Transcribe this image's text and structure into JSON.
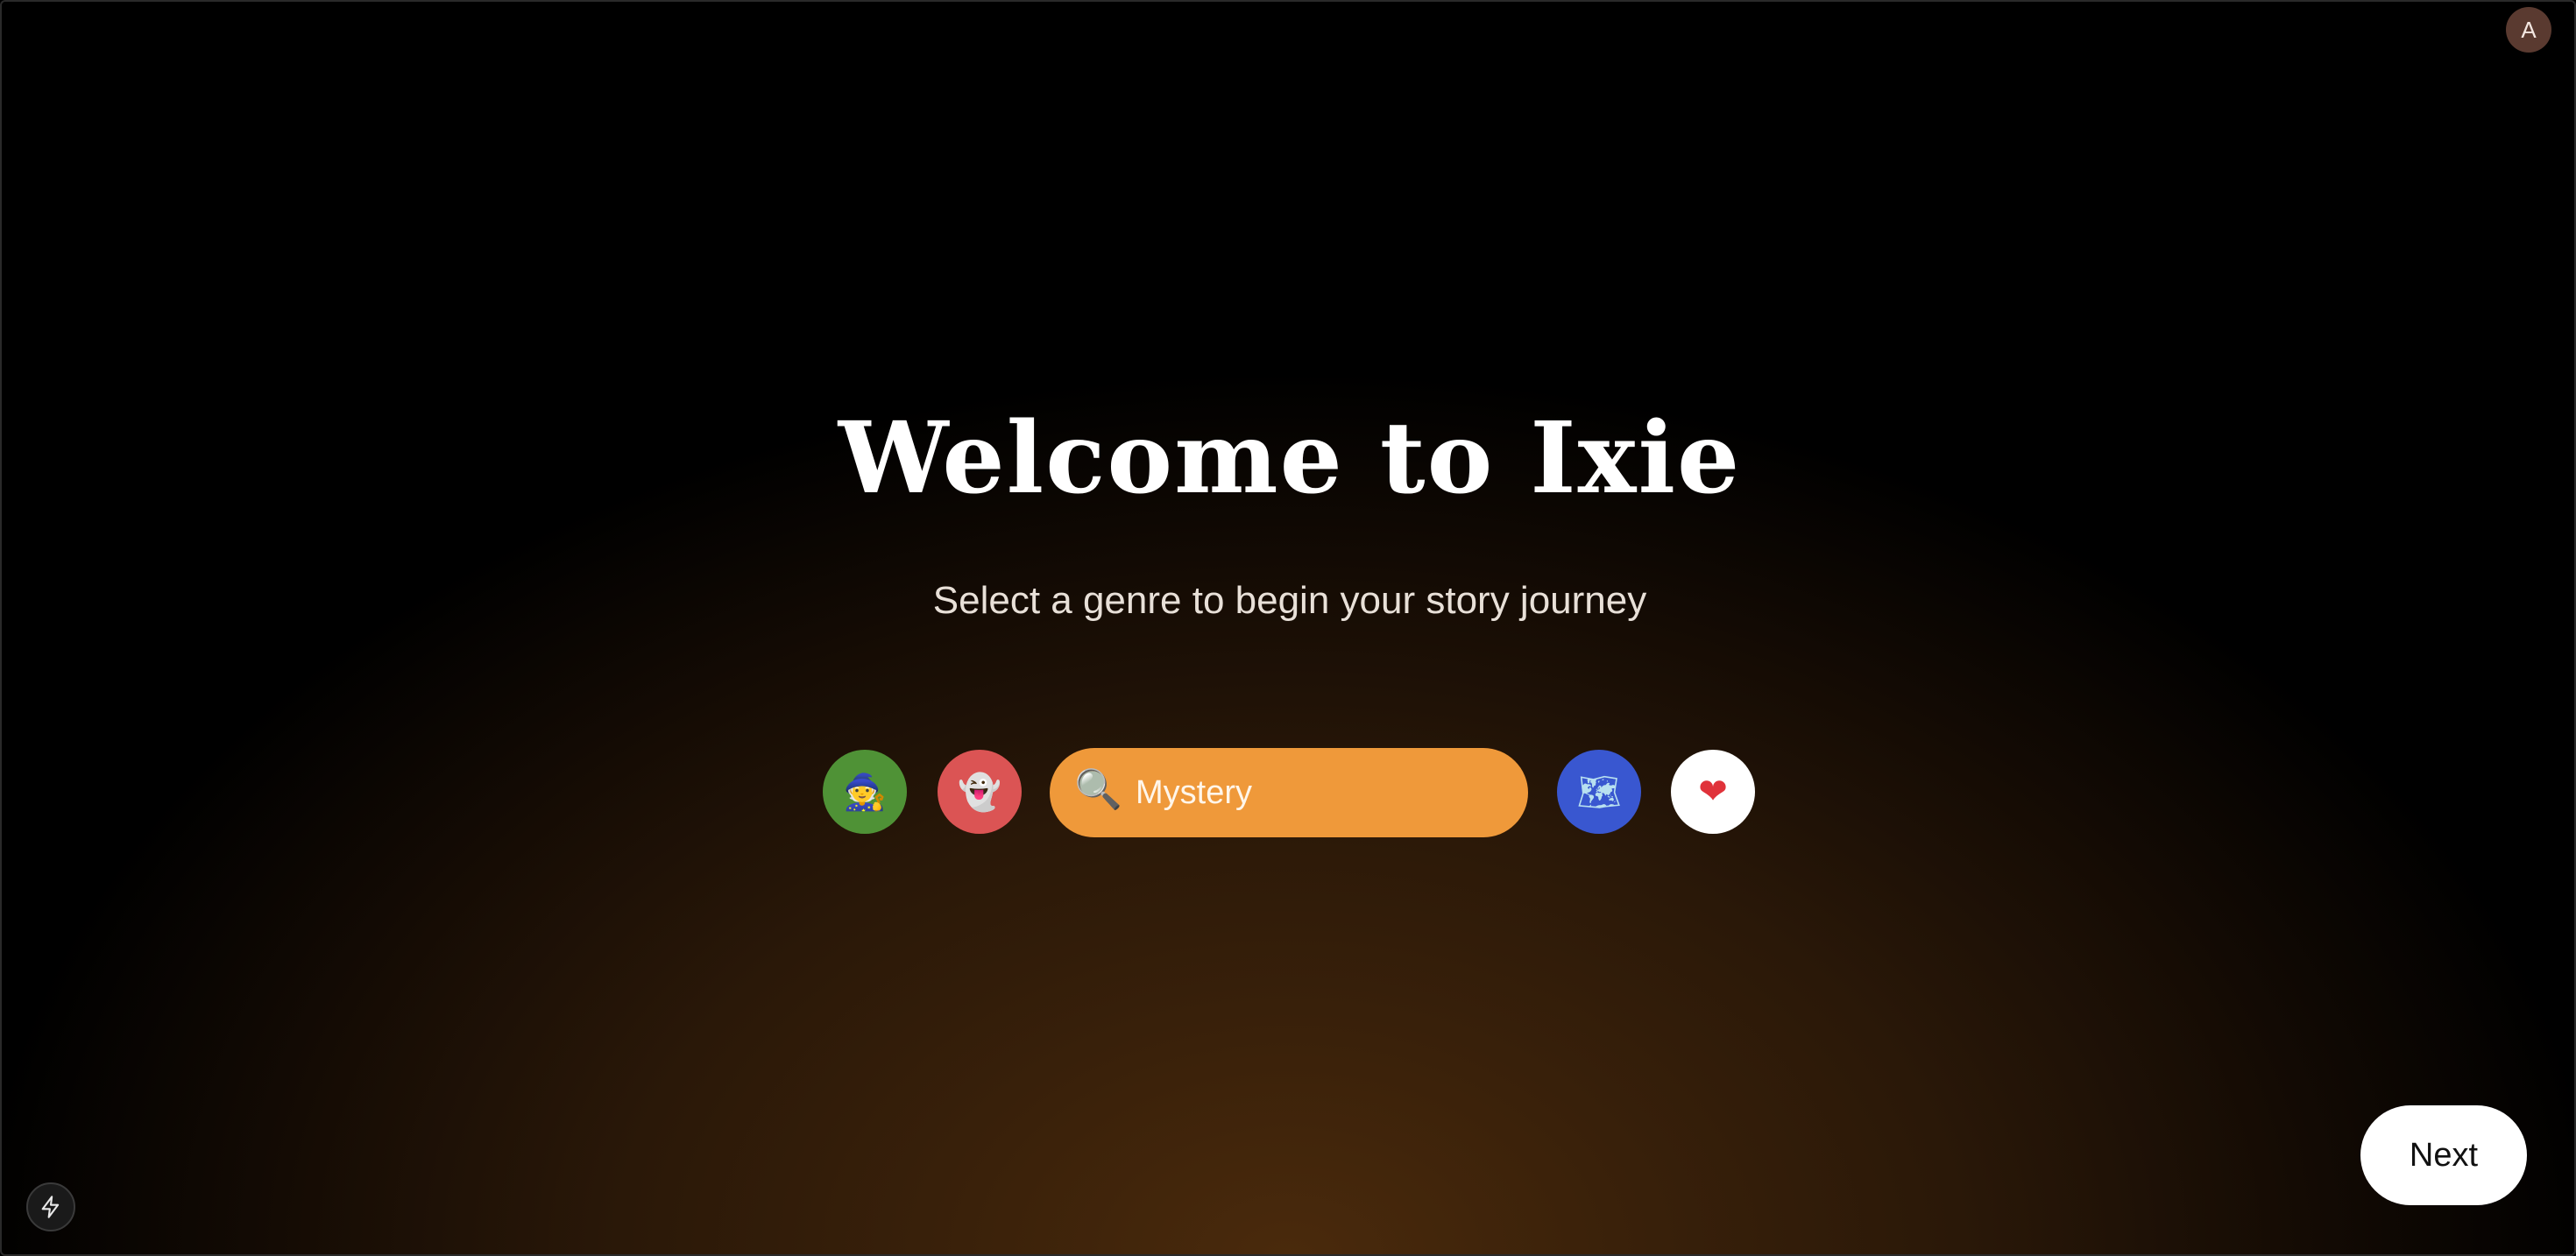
{
  "header": {
    "avatar_initial": "A"
  },
  "hero": {
    "title": "Welcome to Ixie",
    "subtitle": "Select a genre to begin your story journey"
  },
  "genres": {
    "items": [
      {
        "icon": "wizard-icon",
        "glyph": "🧙",
        "color": "#4f9236"
      },
      {
        "icon": "ghost-icon",
        "glyph": "👻",
        "color": "#db5454"
      },
      {
        "icon": "magnifying-glass-icon",
        "glyph": "🔍",
        "label": "Mystery",
        "color": "#ef993a",
        "selected": true
      },
      {
        "icon": "map-icon",
        "glyph": "🗺",
        "color": "#3957d0"
      },
      {
        "icon": "heart-icon",
        "glyph": "❤",
        "color": "#ffffff"
      }
    ]
  },
  "footer": {
    "next_label": "Next",
    "dev_icon": "lightning-bolt-icon"
  }
}
